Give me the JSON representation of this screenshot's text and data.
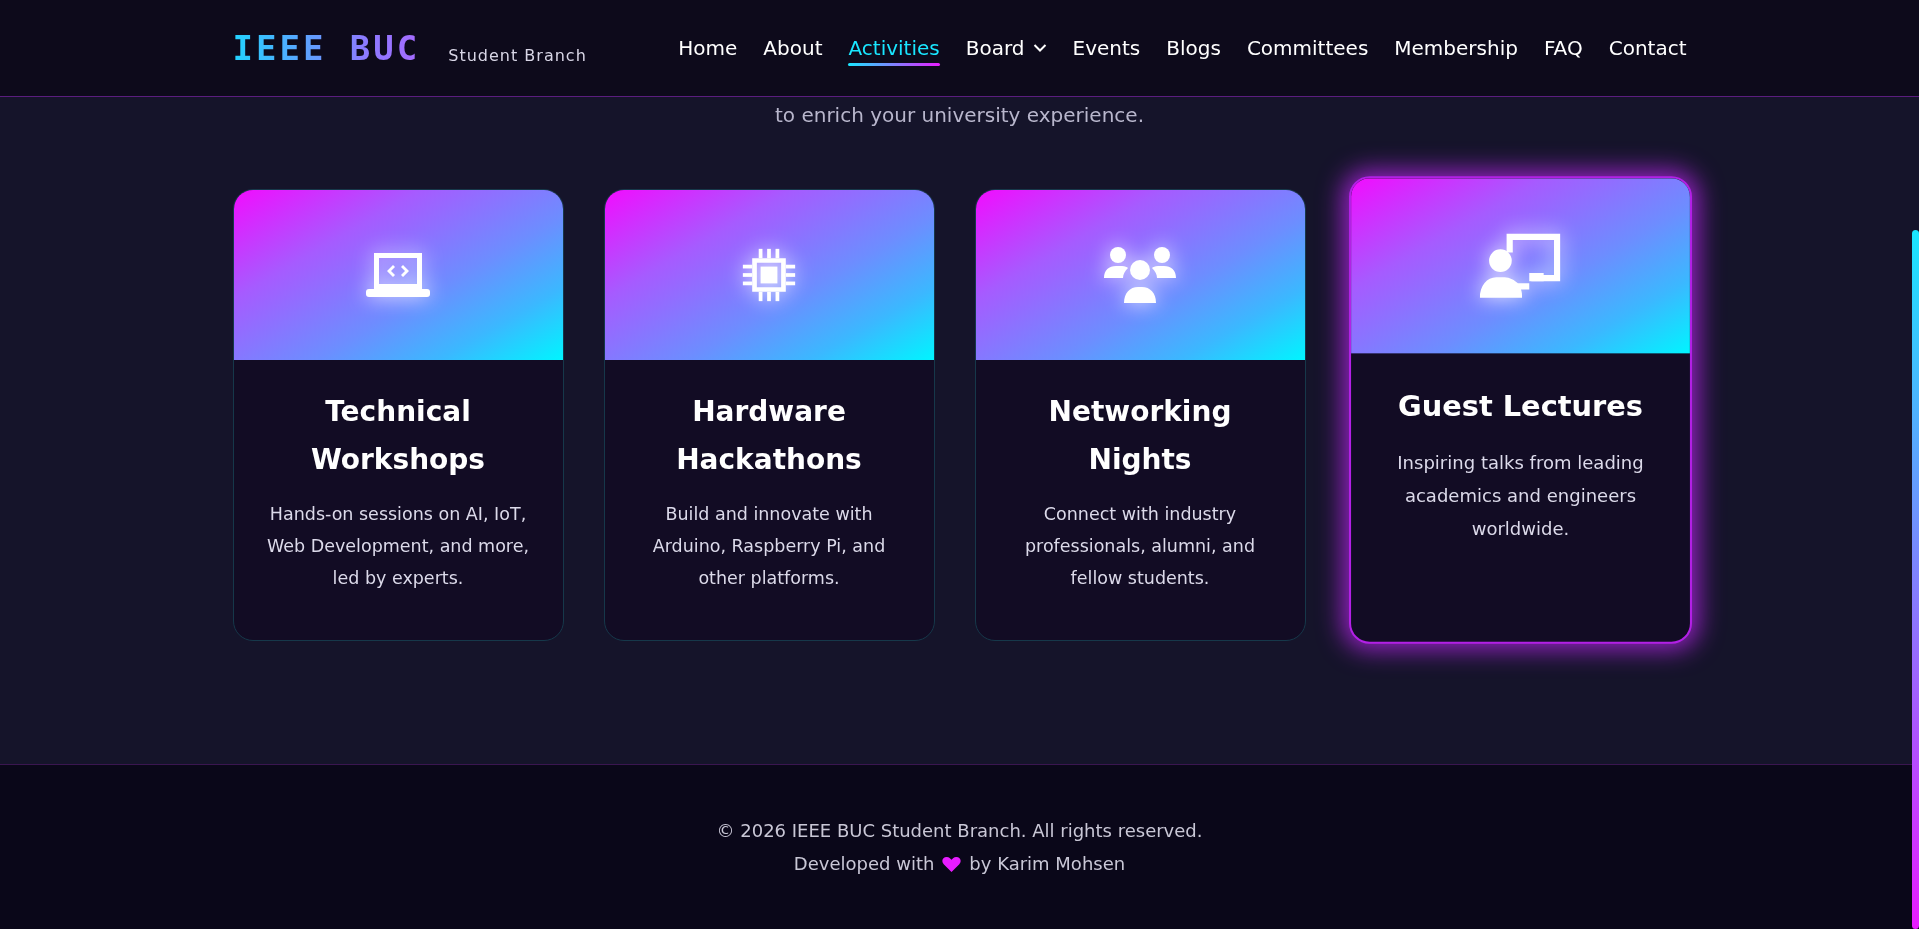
{
  "header": {
    "logo": "IEEE BUC",
    "subtitle": "Student Branch",
    "nav": [
      {
        "label": "Home",
        "selected": false,
        "dropdown": false
      },
      {
        "label": "About",
        "selected": false,
        "dropdown": false
      },
      {
        "label": "Activities",
        "selected": true,
        "dropdown": false
      },
      {
        "label": "Board",
        "selected": false,
        "dropdown": true
      },
      {
        "label": "Events",
        "selected": false,
        "dropdown": false
      },
      {
        "label": "Blogs",
        "selected": false,
        "dropdown": false
      },
      {
        "label": "Committees",
        "selected": false,
        "dropdown": false
      },
      {
        "label": "Membership",
        "selected": false,
        "dropdown": false
      },
      {
        "label": "FAQ",
        "selected": false,
        "dropdown": false
      },
      {
        "label": "Contact",
        "selected": false,
        "dropdown": false
      }
    ]
  },
  "intro": "to enrich your university experience.",
  "cards": [
    {
      "title": "Technical Workshops",
      "description": "Hands-on sessions on AI, IoT, Web Development, and more, led by experts.",
      "highlighted": false
    },
    {
      "title": "Hardware Hackathons",
      "description": "Build and innovate with Arduino, Raspberry Pi, and other platforms.",
      "highlighted": false
    },
    {
      "title": "Networking Nights",
      "description": "Connect with industry professionals, alumni, and fellow students.",
      "highlighted": false
    },
    {
      "title": "Guest Lectures",
      "description": "Inspiring talks from leading academics and engineers worldwide.",
      "highlighted": true
    }
  ],
  "footer": {
    "copyright": "© 2026 IEEE BUC Student Branch. All rights reserved.",
    "credit_before": "Developed with",
    "credit_after": "by Karim Mohsen"
  }
}
